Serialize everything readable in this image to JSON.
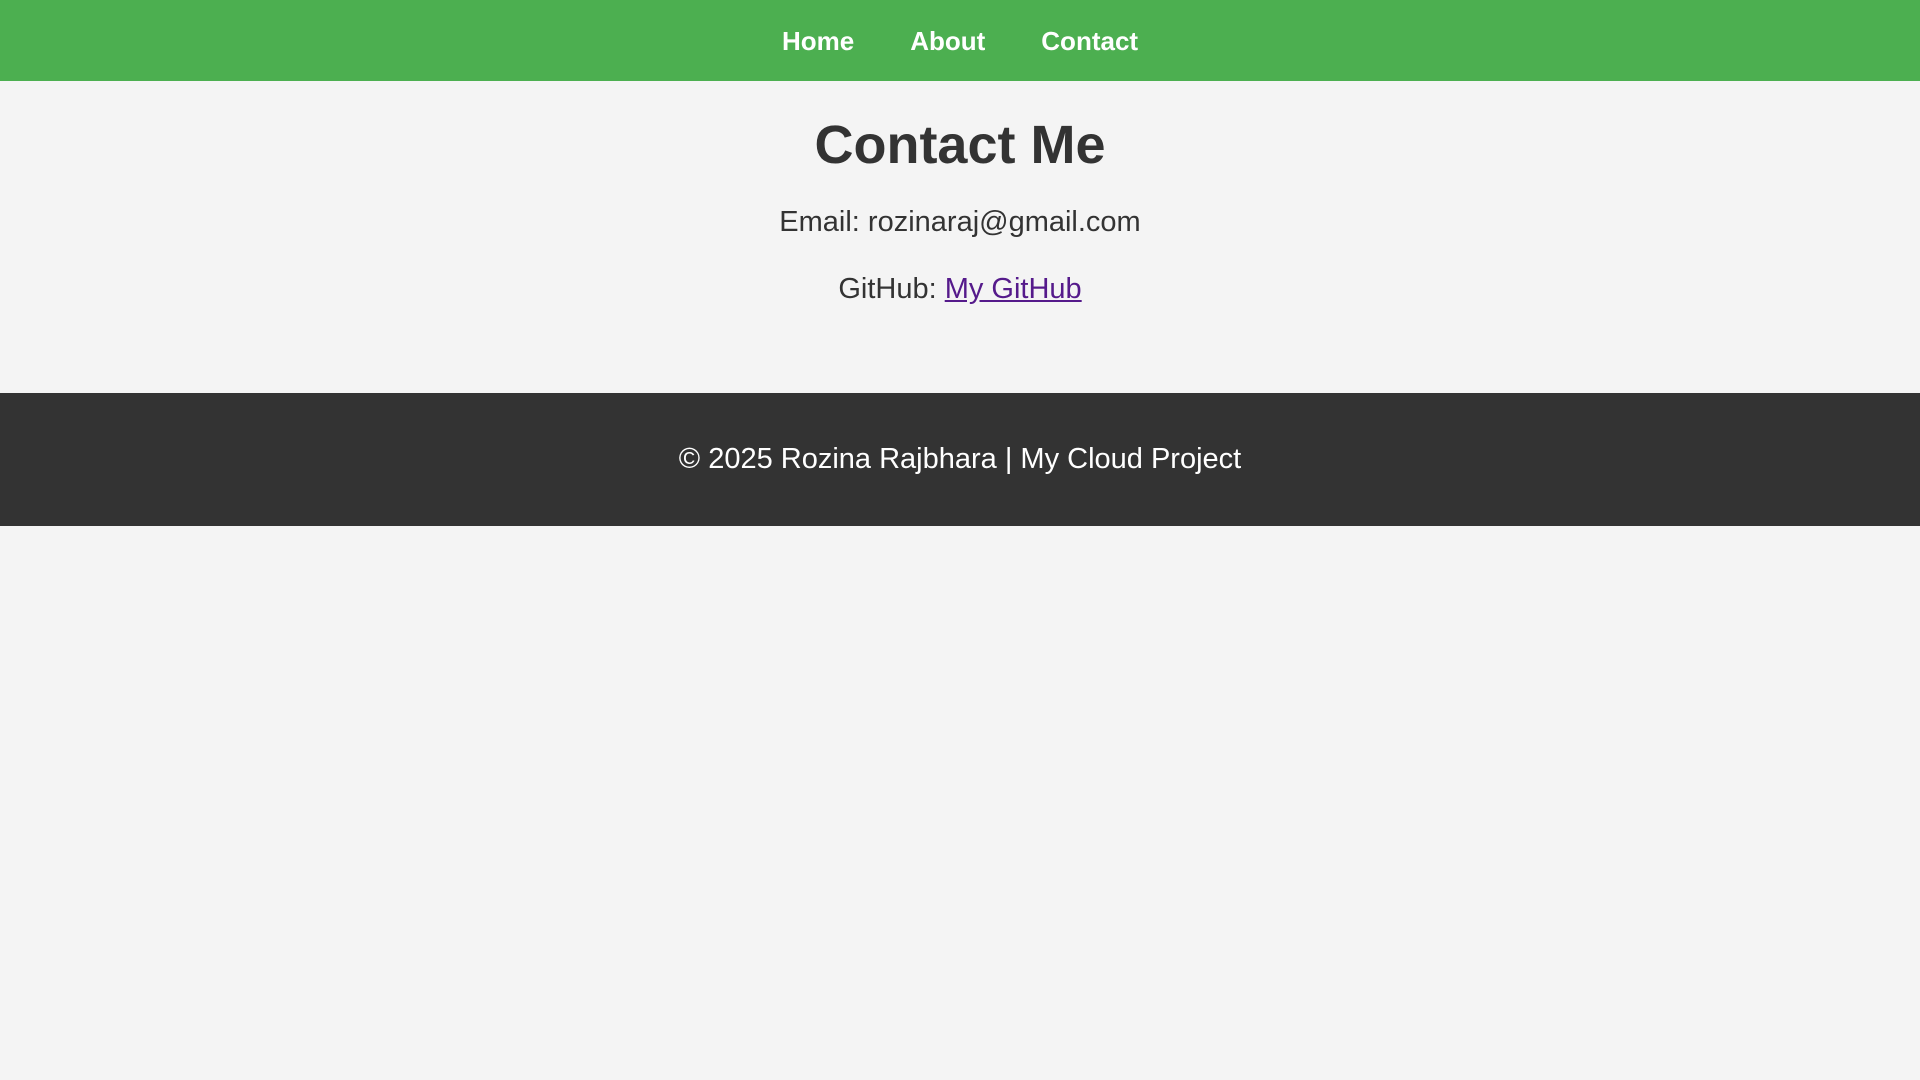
{
  "nav": {
    "items": [
      {
        "label": "Home"
      },
      {
        "label": "About"
      },
      {
        "label": "Contact"
      }
    ]
  },
  "main": {
    "title": "Contact Me",
    "email": {
      "label": "Email:",
      "value": "rozinaraj@gmail.com"
    },
    "github": {
      "label": "GitHub:",
      "link_text": "My GitHub"
    }
  },
  "footer": {
    "text": "© 2025 Rozina Rajbhara | My Cloud Project"
  },
  "colors": {
    "nav_background": "#4caf50",
    "page_background": "#f4f4f4",
    "footer_background": "#333333",
    "text": "#333333",
    "link_visited": "#551a8b"
  }
}
